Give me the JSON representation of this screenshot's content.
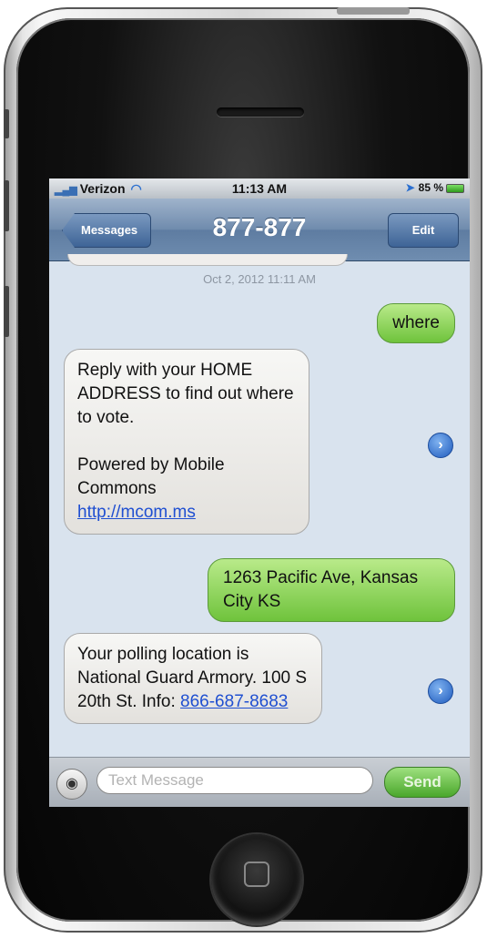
{
  "status_bar": {
    "carrier": "Verizon",
    "time": "11:13 AM",
    "battery": "85 %"
  },
  "nav": {
    "back_label": "Messages",
    "title": "877-877",
    "edit_label": "Edit"
  },
  "conversation": {
    "timestamp": "Oct 2, 2012 11:11 AM",
    "messages": [
      {
        "direction": "out",
        "text": "where"
      },
      {
        "direction": "in",
        "line1": "Reply with your HOME ADDRESS to find out where to vote.",
        "line2": "Powered by Mobile Commons",
        "link": "http://mcom.ms"
      },
      {
        "direction": "out",
        "text": "1263 Pacific Ave, Kansas City KS"
      },
      {
        "direction": "in",
        "text": "Your polling location is National Guard Armory. 100 S 20th St. Info: ",
        "link": "866-687-8683"
      }
    ]
  },
  "composer": {
    "placeholder": "Text Message",
    "send_label": "Send"
  },
  "icons": {
    "signal": "signal-bars-icon",
    "wifi": "wifi-icon",
    "location": "location-arrow-icon",
    "battery": "battery-icon",
    "detail": "chevron-right-circle-icon",
    "camera": "camera-icon",
    "home": "home-button-icon"
  },
  "colors": {
    "bubble_out": "#7ccb45",
    "bubble_in": "#ecebe8",
    "nav_bar": "#6f8bad",
    "link": "#1f4fd1"
  }
}
